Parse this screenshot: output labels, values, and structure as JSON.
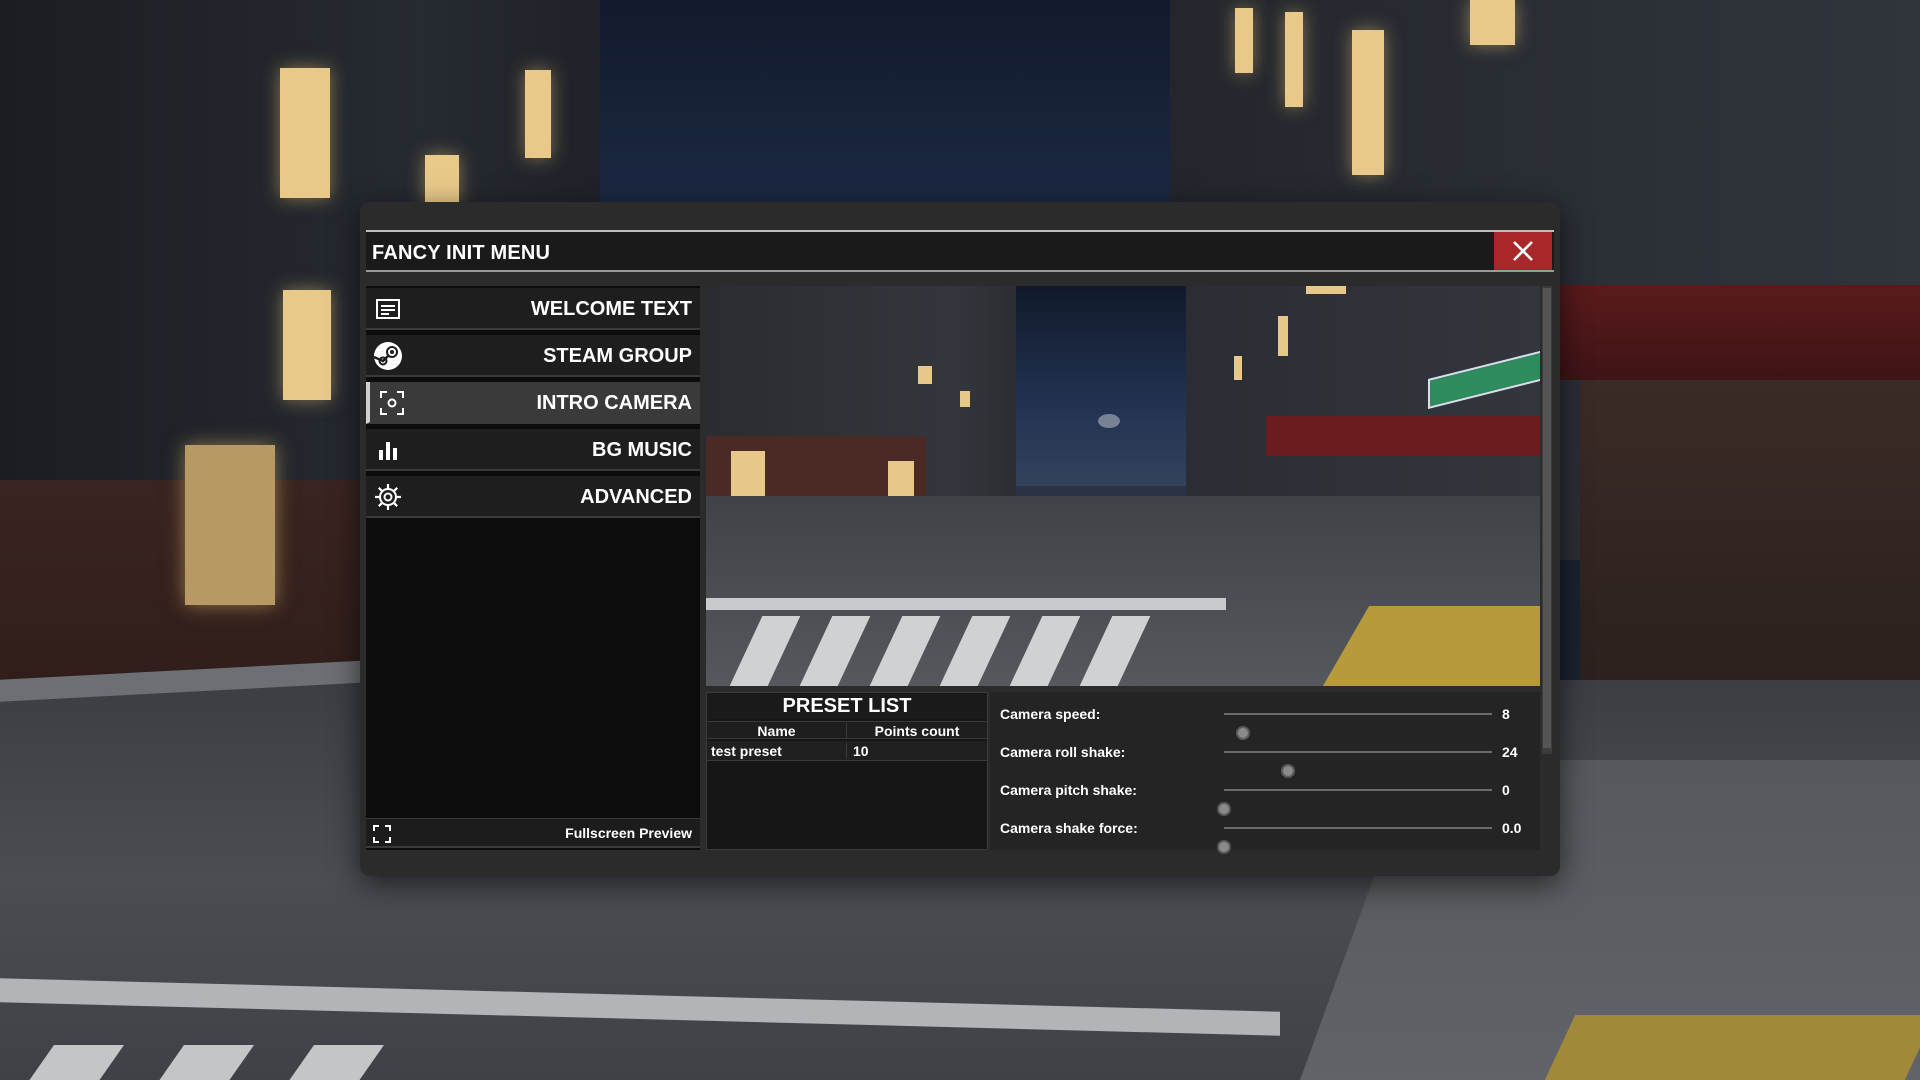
{
  "window": {
    "title": "FANCY INIT MENU",
    "close_icon": "close-icon",
    "accent_close": "#a8282a"
  },
  "nav": {
    "items": [
      {
        "label": "WELCOME TEXT",
        "icon": "text-box-icon",
        "active": false
      },
      {
        "label": "STEAM GROUP",
        "icon": "steam-icon",
        "active": false
      },
      {
        "label": "INTRO CAMERA",
        "icon": "camera-focus-icon",
        "active": true
      },
      {
        "label": "BG MUSIC",
        "icon": "bar-chart-icon",
        "active": false
      },
      {
        "label": "ADVANCED",
        "icon": "gear-icon",
        "active": false
      }
    ],
    "fullscreen_label": "Fullscreen Preview",
    "fullscreen_icon": "fullscreen-icon"
  },
  "preset_list": {
    "title": "PRESET LIST",
    "columns": [
      "Name",
      "Points count"
    ],
    "rows": [
      {
        "name": "test preset",
        "points": "10"
      }
    ]
  },
  "settings": [
    {
      "label": "Camera speed:",
      "value": "8",
      "fraction": 0.07
    },
    {
      "label": "Camera roll shake:",
      "value": "24",
      "fraction": 0.24
    },
    {
      "label": "Camera pitch shake:",
      "value": "0",
      "fraction": 0.0
    },
    {
      "label": "Camera shake force:",
      "value": "0.0",
      "fraction": 0.0
    }
  ]
}
